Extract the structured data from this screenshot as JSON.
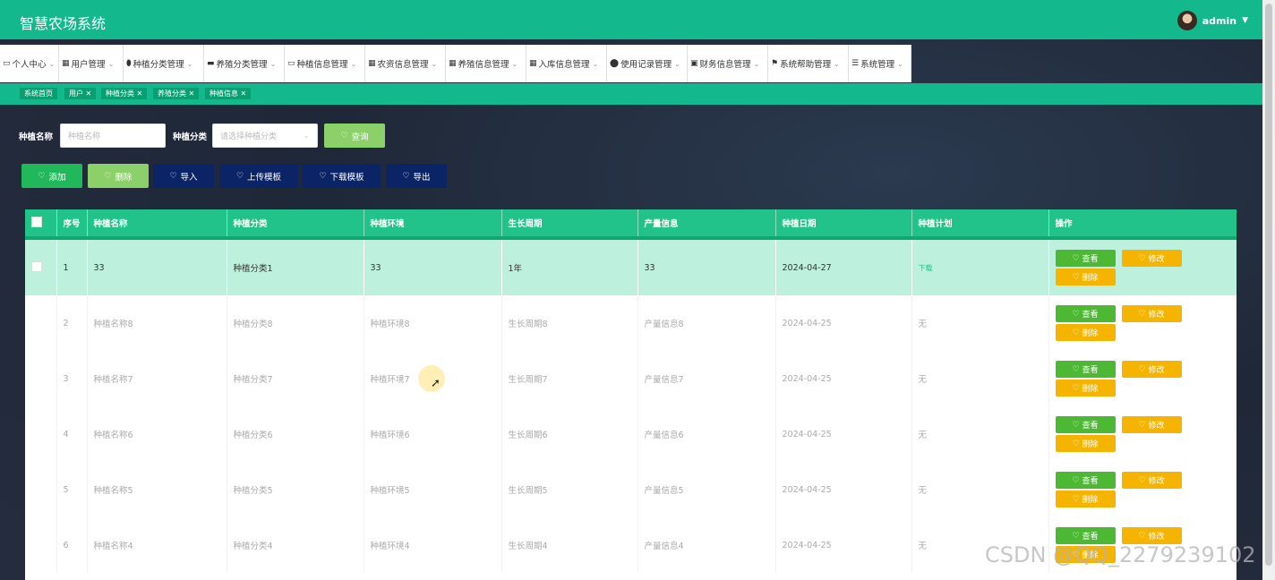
{
  "app": {
    "title": "智慧农场系统",
    "user": "admin"
  },
  "menus": [
    {
      "label": "个人中心",
      "icon": "calendar-icon"
    },
    {
      "label": "用户管理",
      "icon": "grid-icon"
    },
    {
      "label": "种植分类管理",
      "icon": "pin-icon"
    },
    {
      "label": "养殖分类管理",
      "icon": "chat-icon"
    },
    {
      "label": "种植信息管理",
      "icon": "monitor-icon"
    },
    {
      "label": "农资信息管理",
      "icon": "grid-icon"
    },
    {
      "label": "养殖信息管理",
      "icon": "grid-icon"
    },
    {
      "label": "入库信息管理",
      "icon": "grid-icon"
    },
    {
      "label": "使用记录管理",
      "icon": "user-icon"
    },
    {
      "label": "财务信息管理",
      "icon": "clipboard-icon"
    },
    {
      "label": "系统帮助管理",
      "icon": "flag-icon"
    },
    {
      "label": "系统管理",
      "icon": "list-icon"
    }
  ],
  "tags": [
    "系统首页",
    "用户 ✕",
    "种植分类 ✕",
    "养殖分类 ✕",
    "种植信息 ✕"
  ],
  "search": {
    "name_label": "种植名称",
    "name_placeholder": "种植名称",
    "cat_label": "种植分类",
    "cat_placeholder": "请选择种植分类",
    "query_button": "查询"
  },
  "actions": {
    "add": "添加",
    "delete": "删除",
    "import": "导入",
    "upload": "上传模板",
    "download": "下载模板",
    "export": "导出"
  },
  "table": {
    "columns": [
      "序号",
      "种植名称",
      "种植分类",
      "种植环境",
      "生长周期",
      "产量信息",
      "种植日期",
      "种植计划",
      "操作"
    ],
    "rows": [
      {
        "no": "1",
        "name": "33",
        "cat": "种植分类1",
        "env": "33",
        "cycle": "1年",
        "yield": "33",
        "date": "2024-04-27",
        "plan": "下载"
      },
      {
        "no": "2",
        "name": "种植名称8",
        "cat": "种植分类8",
        "env": "种植环境8",
        "cycle": "生长周期8",
        "yield": "产量信息8",
        "date": "2024-04-25",
        "plan": "无"
      },
      {
        "no": "3",
        "name": "种植名称7",
        "cat": "种植分类7",
        "env": "种植环境7",
        "cycle": "生长周期7",
        "yield": "产量信息7",
        "date": "2024-04-25",
        "plan": "无"
      },
      {
        "no": "4",
        "name": "种植名称6",
        "cat": "种植分类6",
        "env": "种植环境6",
        "cycle": "生长周期6",
        "yield": "产量信息6",
        "date": "2024-04-25",
        "plan": "无"
      },
      {
        "no": "5",
        "name": "种植名称5",
        "cat": "种植分类5",
        "env": "种植环境5",
        "cycle": "生长周期5",
        "yield": "产量信息5",
        "date": "2024-04-25",
        "plan": "无"
      },
      {
        "no": "6",
        "name": "种植名称4",
        "cat": "种植分类4",
        "env": "种植环境4",
        "cycle": "生长周期4",
        "yield": "产量信息4",
        "date": "2024-04-25",
        "plan": "无"
      }
    ],
    "row_ops": {
      "view": "查看",
      "edit": "修改",
      "delete": "删除"
    }
  },
  "watermark": "CSDN @QQ_2279239102",
  "colors": {
    "primary": "#13b88d",
    "header": "#21c38a",
    "view": "#4cb833",
    "edit": "#f5b400",
    "navy": "#0b2466",
    "lightgreen": "#8cd06a"
  }
}
